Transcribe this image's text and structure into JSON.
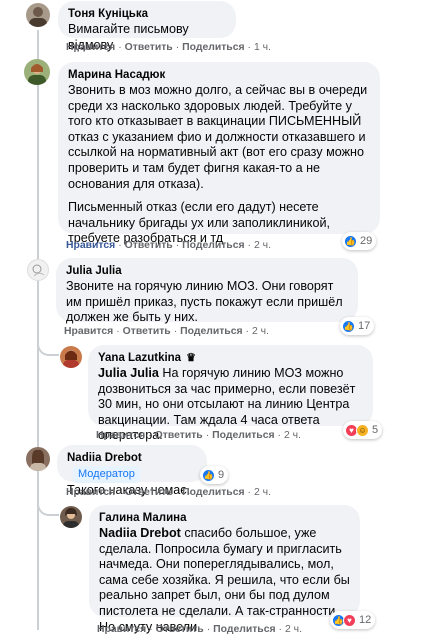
{
  "actions": {
    "like": "Нравится",
    "reply": "Ответить",
    "share": "Поделиться"
  },
  "comments": [
    {
      "author": "Тоня Куніцька",
      "text": "Вимагайте письмову відмову.",
      "time": "1 ч."
    },
    {
      "author": "Марина Насадюк",
      "text": "Звонить в моз можно долго, а сейчас вы в очереди среди хз насколько здоровых людей. Требуйте у того кто отказывает в вакцинации ПИСЬМЕННЫЙ отказ с указанием фио и должности отказавшего и ссылкой на нормативный акт (вот его сразу можно проверить и там будет фигня какая-то а не основания для отказа).",
      "text2": "Письменный отказ (если его дадут) несете начальнику бригады ух или заполиклиникой, требуете разобраться и тд",
      "time": "2 ч.",
      "reactions": "29"
    },
    {
      "author": "Julia Julia",
      "text": "Звоните на горячую линию МОЗ. Они говорят им пришёл приказ, пусть покажут если пришёл должен же быть у них.",
      "time": "2 ч.",
      "reactions": "17"
    },
    {
      "author": "Yana Lazutkina",
      "mention": "Julia Julia",
      "text": " На горячую линию МОЗ можно дозвониться за час примерно, если повезёт 30 мин, но они отсылают на линию Центра вакцинации. Там ждала 4 часа ответа оператора.",
      "time": "2 ч.",
      "reactions": "5"
    },
    {
      "author": "Nadiia Drebot",
      "badge": "Модератор",
      "text": "Такого наказу немає.",
      "time": "2 ч.",
      "reactions": "9"
    },
    {
      "author": "Галина Малина",
      "mention": "Nadiia Drebot",
      "text": " спасибо большое, уже сделала. Попросила бумагу и пригласить начмеда. Они попереглядывались, мол, сама себе хозяйка. Я решила, что если бы реально запрет был, они бы под дулом пистолета не сделали. А так-странности. Но смуту навели.",
      "time": "2 ч.",
      "reactions": "12"
    }
  ],
  "colors": {
    "bubble": "#f0f2f5",
    "link_blue": "#385898",
    "like_blue": "#1877f2",
    "meta_gray": "#65676b"
  }
}
